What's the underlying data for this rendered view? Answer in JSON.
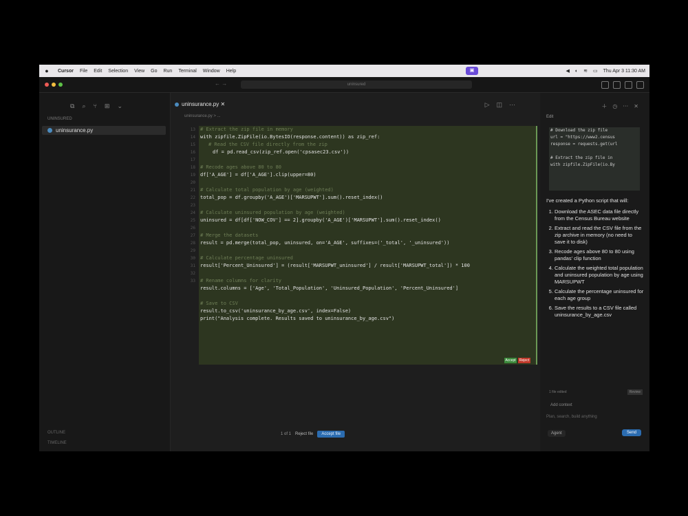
{
  "menubar": {
    "apple": "",
    "items": [
      "Cursor",
      "File",
      "Edit",
      "Selection",
      "View",
      "Go",
      "Run",
      "Terminal",
      "Window",
      "Help"
    ],
    "clock": "Thu Apr 3 11:30 AM"
  },
  "titlebar": {
    "nav": "← →",
    "command_center": "uninsured"
  },
  "sidebar": {
    "folder": "UNINSURED",
    "file": "uninsurance.py",
    "bottom1": "OUTLINE",
    "bottom2": "TIMELINE"
  },
  "editor": {
    "tab_label": "uninsurance.py",
    "breadcrumb": "uninsurance.py > ...",
    "line_numbers": [
      "13",
      "14",
      "15",
      "16",
      "17",
      "18",
      "19",
      "20",
      "21",
      "22",
      "23",
      "24",
      "25",
      "26",
      "27",
      "28",
      "29",
      "30",
      "31",
      "32",
      "33"
    ],
    "code_lines": [
      {
        "text": "# Extract the zip file in memory",
        "cls": "cm"
      },
      {
        "text": "with zipfile.ZipFile(io.BytesIO(response.content)) as zip_ref:",
        "cls": ""
      },
      {
        "text": "# Read the CSV file directly from the zip",
        "cls": "cm indent"
      },
      {
        "text": "df = pd.read_csv(zip_ref.open('cpsasec23.csv'))",
        "cls": "indent2"
      },
      {
        "text": "",
        "cls": ""
      },
      {
        "text": "# Recode ages above 80 to 80",
        "cls": "cm"
      },
      {
        "text": "df['A_AGE'] = df['A_AGE'].clip(upper=80)",
        "cls": ""
      },
      {
        "text": "",
        "cls": ""
      },
      {
        "text": "# Calculate total population by age (weighted)",
        "cls": "cm"
      },
      {
        "text": "total_pop = df.groupby('A_AGE')['MARSUPWT'].sum().reset_index()",
        "cls": ""
      },
      {
        "text": "",
        "cls": ""
      },
      {
        "text": "# Calculate uninsured population by age (weighted)",
        "cls": "cm"
      },
      {
        "text": "uninsured = df[df['NOW_COV'] == 2].groupby('A_AGE')['MARSUPWT'].sum().reset_index()",
        "cls": ""
      },
      {
        "text": "",
        "cls": ""
      },
      {
        "text": "# Merge the datasets",
        "cls": "cm"
      },
      {
        "text": "result = pd.merge(total_pop, uninsured, on='A_AGE', suffixes=('_total', '_uninsured'))",
        "cls": ""
      },
      {
        "text": "",
        "cls": ""
      },
      {
        "text": "# Calculate percentage uninsured",
        "cls": "cm"
      },
      {
        "text": "result['Percent_Uninsured'] = (result['MARSUPWT_uninsured'] / result['MARSUPWT_total']) * 100",
        "cls": ""
      },
      {
        "text": "",
        "cls": ""
      },
      {
        "text": "# Rename columns for clarity",
        "cls": "cm"
      },
      {
        "text": "result.columns = ['Age', 'Total_Population', 'Uninsured_Population', 'Percent_Uninsured']",
        "cls": ""
      },
      {
        "text": "",
        "cls": ""
      },
      {
        "text": "# Save to CSV",
        "cls": "cm"
      },
      {
        "text": "result.to_csv('uninsurance_by_age.csv', index=False)",
        "cls": ""
      },
      {
        "text": "print(\"Analysis complete. Results saved to uninsurance_by_age.csv\")",
        "cls": ""
      }
    ],
    "accept_label": "Accept",
    "reject_label": "Reject",
    "diff_counter": "1 of 1",
    "reject_file": "Reject file",
    "accept_file": "Accept file"
  },
  "panel": {
    "tab": "Edit",
    "snippet": [
      "# Download the zip file",
      "url = \"https://www2.census",
      "response = requests.get(url",
      "",
      "# Extract the zip file in",
      "with zipfile.ZipFile(io.By"
    ],
    "intro": "I've created a Python script that will:",
    "steps": [
      "Download the ASEC data file directly from the Census Bureau website",
      "Extract and read the CSV file from the zip archive in memory (no need to save it to disk)",
      "Recode ages above 80 to 80 using pandas' clip function",
      "Calculate the weighted total population and uninsured population by age using MARSUPWT",
      "Calculate the percentage uninsured for each age group",
      "Save the results to a CSV file called uninsurance_by_age.csv"
    ],
    "meta_left": "1 file edited",
    "meta_right": "Review",
    "add_context": "Add context",
    "input_placeholder": "Plan, search, build anything",
    "agent_label": "Agent",
    "at_label": "@",
    "send_label": "Send"
  }
}
